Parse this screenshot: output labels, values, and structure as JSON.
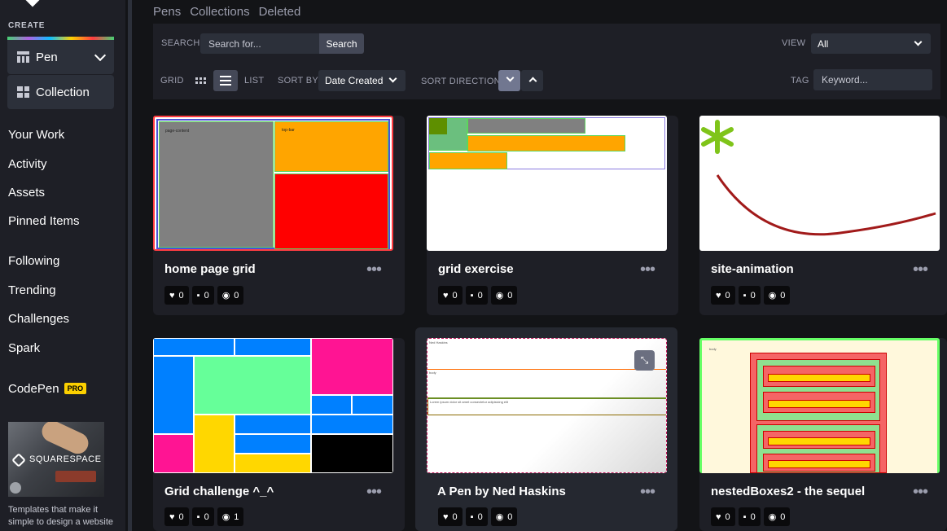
{
  "sidebar": {
    "create_label": "CREATE",
    "pen_label": "Pen",
    "collection_label": "Collection",
    "nav": [
      "Your Work",
      "Activity",
      "Assets",
      "Pinned Items",
      "Following",
      "Trending",
      "Challenges",
      "Spark",
      "CodePen"
    ],
    "pro_badge": "PRO",
    "ad_brand": "SQUARESPACE",
    "ad_text": "Templates that make it simple to design a website"
  },
  "tabs": [
    "Pens",
    "Collections",
    "Deleted"
  ],
  "filters": {
    "search_label": "SEARCH",
    "search_placeholder": "Search for...",
    "search_button": "Search",
    "view_label": "VIEW",
    "view_value": "All",
    "grid_label": "GRID",
    "list_label": "LIST",
    "sort_by_label": "SORT BY",
    "sort_by_value": "Date Created",
    "sort_direction_label": "SORT DIRECTION",
    "tag_label": "TAG",
    "keyword_placeholder": "Keyword..."
  },
  "cards": [
    {
      "title": "home page grid",
      "likes": "0",
      "comments": "0",
      "views": "0"
    },
    {
      "title": "grid exercise",
      "likes": "0",
      "comments": "0",
      "views": "0"
    },
    {
      "title": "site-animation",
      "likes": "0",
      "comments": "0",
      "views": "0"
    },
    {
      "title": "Grid challenge ^_^",
      "likes": "0",
      "comments": "0",
      "views": "1"
    },
    {
      "title": "A Pen by Ned Haskins",
      "likes": "0",
      "comments": "0",
      "views": "0"
    },
    {
      "title": "nestedBoxes2 - the sequel",
      "likes": "0",
      "comments": "0",
      "views": "0"
    }
  ],
  "thumb_text": {
    "card1_left": "page-content",
    "card1_right": "top-bar",
    "card5_top": "Ned Haskins",
    "card5_mid": "body",
    "card5_bottom": "Lorem ipsum dolor sit amet consectetur adipisicing elit",
    "card6_label": "body"
  },
  "colors": {
    "bg": "#131417",
    "panel": "#1e1f26",
    "control": "#2c303a",
    "accent_pro": "#fcd000"
  }
}
